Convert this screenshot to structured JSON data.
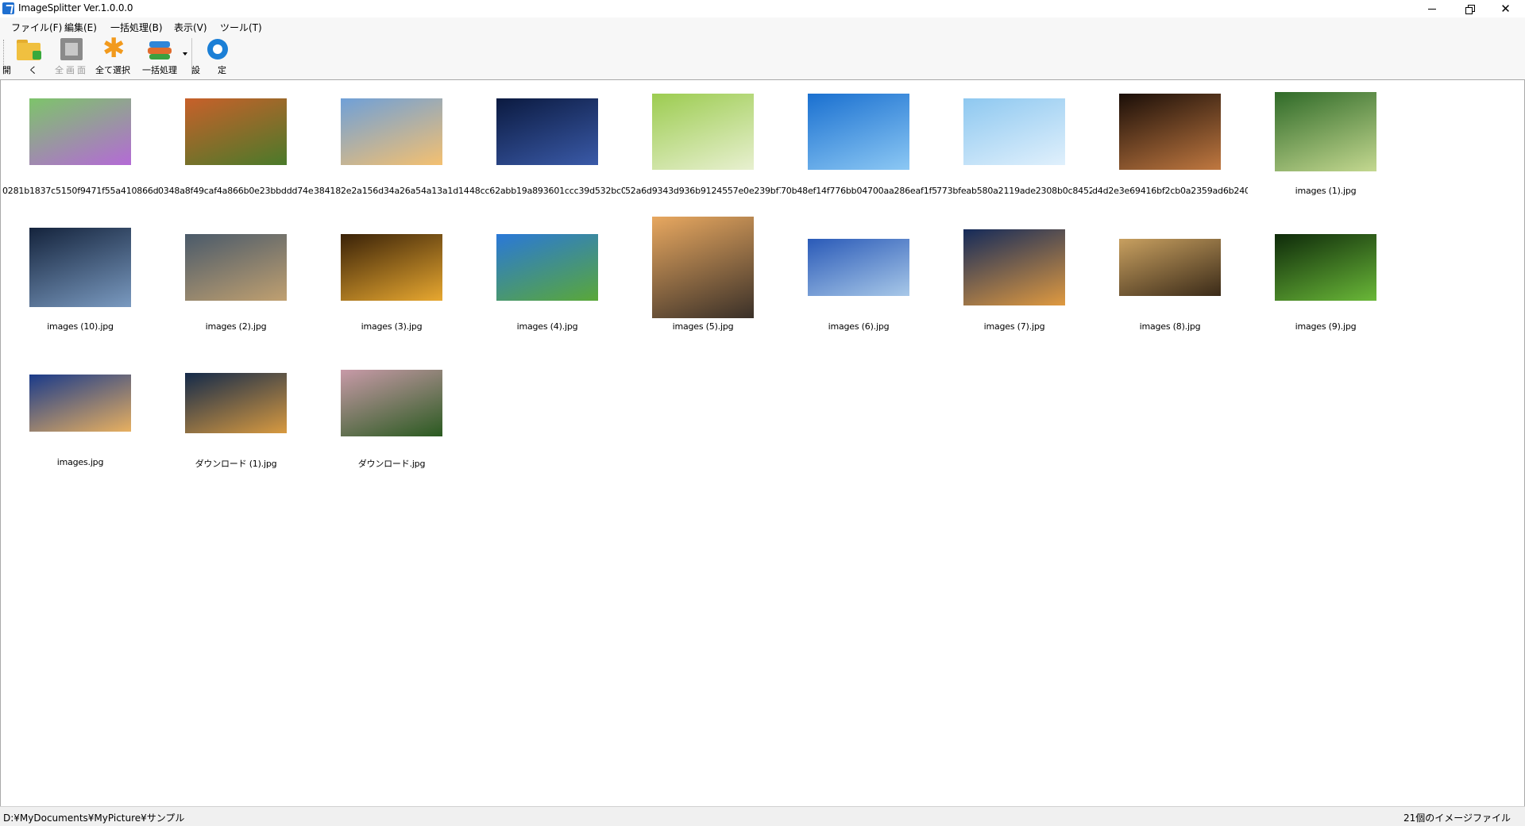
{
  "window": {
    "title": "ImageSplitter Ver.1.0.0.0",
    "controls": {
      "minimize": "minimize",
      "maximize": "restore",
      "close": "✕"
    }
  },
  "menu": [
    "ファイル(F)",
    "編集(E)",
    "一括処理(B)",
    "表示(V)",
    "ツール(T)"
  ],
  "toolbar": {
    "open_label": "開く",
    "fullscreen_label": "全画面",
    "select_all_label": "全て選択",
    "batch_label": "一括処理",
    "settings_label": "設定"
  },
  "files": [
    {
      "name": "0281b1837c5150f9471f55a410866d7…",
      "colors": [
        "#7dc46a",
        "#b46ad6"
      ]
    },
    {
      "name": "0348a8f49caf4a866b0e23bbddd74ea…",
      "colors": [
        "#c8602a",
        "#4a7a2a"
      ]
    },
    {
      "name": "384182e2a156d34a26a54a13a1d1460…",
      "colors": [
        "#6fa0d8",
        "#f4c070"
      ]
    },
    {
      "name": "48cc62abb19a893601ccc39d532bc0b…",
      "colors": [
        "#0b1a40",
        "#3a5aa8"
      ]
    },
    {
      "name": "52a6d9343d936b9124557e0e239bf78…",
      "colors": [
        "#9ccc50",
        "#e8f0d0"
      ]
    },
    {
      "name": "70b48ef14f776bb04700aa286eaf1f5…",
      "colors": [
        "#1a70d0",
        "#8cc8f4"
      ]
    },
    {
      "name": "773bfeab580a2119ade2308b0c84528…",
      "colors": [
        "#8ec8f0",
        "#e0f0fc"
      ]
    },
    {
      "name": "d4d2e3e69416bf2cb0a2359ad6b240e…",
      "colors": [
        "#1a0e08",
        "#c07840"
      ]
    },
    {
      "name": "images (1).jpg",
      "colors": [
        "#2f6a28",
        "#c4d890"
      ]
    },
    {
      "name": "images (10).jpg",
      "colors": [
        "#14233c",
        "#7a9ac0"
      ]
    },
    {
      "name": "images (2).jpg",
      "colors": [
        "#4a5a6a",
        "#c0a070"
      ]
    },
    {
      "name": "images (3).jpg",
      "colors": [
        "#3a2208",
        "#e8a830"
      ]
    },
    {
      "name": "images (4).jpg",
      "colors": [
        "#2a78d8",
        "#5aa838"
      ]
    },
    {
      "name": "images (5).jpg",
      "colors": [
        "#e8a860",
        "#3a3028"
      ]
    },
    {
      "name": "images (6).jpg",
      "colors": [
        "#2a5ab8",
        "#a8c8e8"
      ]
    },
    {
      "name": "images (7).jpg",
      "colors": [
        "#142a5a",
        "#e09a40"
      ]
    },
    {
      "name": "images (8).jpg",
      "colors": [
        "#c8a060",
        "#3a2a18"
      ]
    },
    {
      "name": "images (9).jpg",
      "colors": [
        "#0e2a0a",
        "#6ab838"
      ]
    },
    {
      "name": "images.jpg",
      "colors": [
        "#1a3a8a",
        "#e8b060"
      ]
    },
    {
      "name": "ダウンロード (1).jpg",
      "colors": [
        "#142a4a",
        "#d89a40"
      ]
    },
    {
      "name": "ダウンロード.jpg",
      "colors": [
        "#c89aa8",
        "#2a5a20"
      ]
    }
  ],
  "status": {
    "path": "D:¥MyDocuments¥MyPicture¥サンプル",
    "count": "21個のイメージファイル"
  }
}
